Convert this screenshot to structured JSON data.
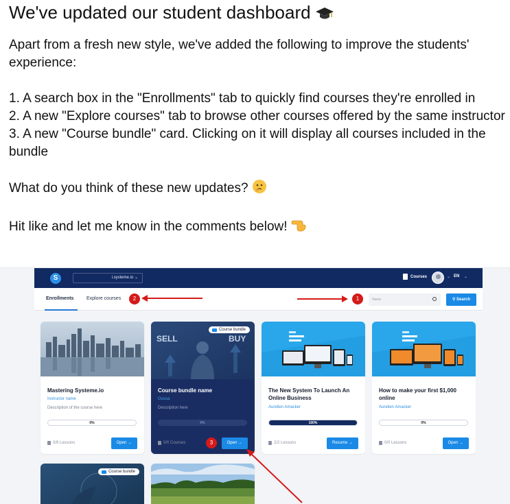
{
  "post": {
    "title": "We've updated our student dashboard",
    "intro": "Apart from a fresh new style, we've added the following to improve the students' experience:",
    "item1": "1. A search box in the \"Enrollments\" tab to quickly find courses they're enrolled in",
    "item2": "2. A new \"Explore courses\" tab to browse other courses offered by the same instructor",
    "item3": "3. A new \"Course bundle\" card. Clicking on it will display all courses included in the bundle",
    "question": "What do you think of these new updates?",
    "cta": "Hit like and let me know in the comments below!"
  },
  "dashboard": {
    "logo": "S",
    "site_select": "i.systeme.io",
    "nav_courses": "Courses",
    "language": "EN",
    "tabs": [
      {
        "label": "Enrollments",
        "active": true
      },
      {
        "label": "Explore courses",
        "active": false
      }
    ],
    "search_placeholder": "Name",
    "search_button": "Search",
    "annotations": {
      "badge1": "1",
      "badge2": "2",
      "badge3": "3"
    },
    "cards": [
      {
        "title": "Mastering Systeme.io",
        "instructor": "Instructor name",
        "description": "Description of the course here",
        "progress_label": "0%",
        "progress": 0,
        "lessons": "0/9 Lessons",
        "button": "Open →",
        "bundle": false
      },
      {
        "title": "Course bundle name",
        "instructor": "Oussa",
        "description": "Description here",
        "progress_label": "0%",
        "progress": 0,
        "lessons": "0/0 Courses",
        "button": "Open →",
        "bundle": true,
        "bundle_tag": "Course bundle",
        "image_text_left": "SELL",
        "image_text_right": "BUY"
      },
      {
        "title": "The New System To Launch An Online Business",
        "instructor": "Aurelien Amacker",
        "description": "",
        "progress_label": "100%",
        "progress": 100,
        "lessons": "2/2 Lessons",
        "button": "Resume →",
        "bundle": false
      },
      {
        "title": "How to make your first $1,000 online",
        "instructor": "Aurelien Amacker",
        "description": "",
        "progress_label": "0%",
        "progress": 0,
        "lessons": "0/0 Lessons",
        "button": "Open →",
        "bundle": false
      }
    ],
    "row2_bundle_tag": "Course bundle"
  },
  "colors": {
    "navy": "#112a62",
    "accent": "#1a8ae6",
    "annotation_red": "#d51a1a"
  }
}
